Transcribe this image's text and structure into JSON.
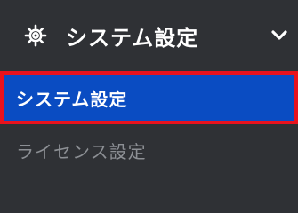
{
  "sidebar": {
    "group": {
      "label": "システム設定",
      "icon": "gear-icon",
      "expand_icon": "chevron-down-icon"
    },
    "items": [
      {
        "label": "システム設定",
        "state": "active"
      },
      {
        "label": "ライセンス設定",
        "state": "inactive"
      }
    ]
  },
  "colors": {
    "background": "#2f3135",
    "active_background": "#0a4cc2",
    "highlight_border": "#e8121d",
    "text": "#ffffff",
    "muted_text": "#8c8f94"
  }
}
